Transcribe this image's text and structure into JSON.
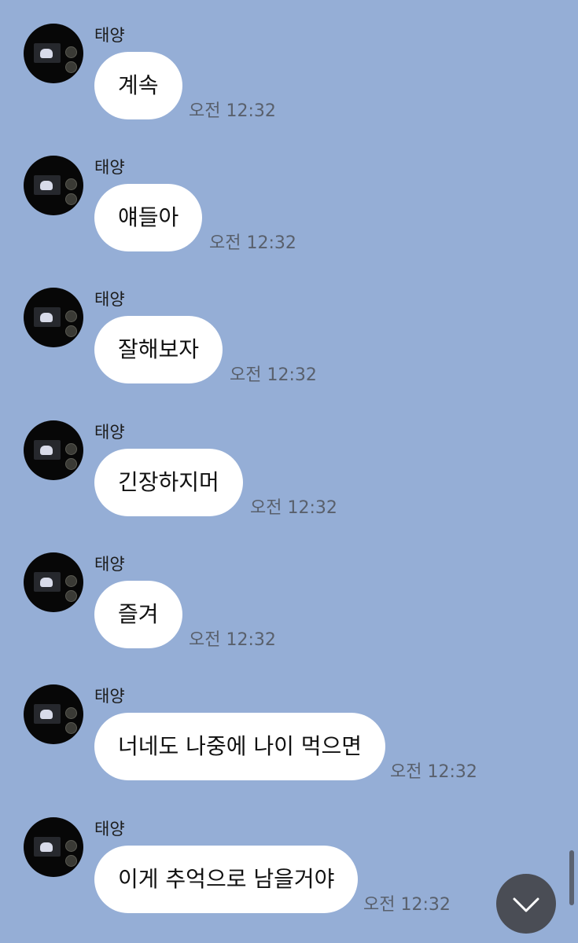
{
  "messages": [
    {
      "sender": "태양",
      "text": "계속",
      "time": "오전 12:32"
    },
    {
      "sender": "태양",
      "text": "얘들아",
      "time": "오전 12:32"
    },
    {
      "sender": "태양",
      "text": "잘해보자",
      "time": "오전 12:32"
    },
    {
      "sender": "태양",
      "text": "긴장하지머",
      "time": "오전 12:32"
    },
    {
      "sender": "태양",
      "text": "즐겨",
      "time": "오전 12:32"
    },
    {
      "sender": "태양",
      "text": "너네도 나중에 나이 먹으면",
      "time": "오전 12:32"
    },
    {
      "sender": "태양",
      "text": "이게 추억으로 남을거야",
      "time": "오전 12:32"
    }
  ],
  "colors": {
    "background": "#95aed6",
    "bubble": "#ffffff",
    "scroll_button": "#4a4d55",
    "time_text": "#59606c"
  },
  "icons": {
    "scroll_down": "chevron-down-icon",
    "avatar": "avatar"
  }
}
